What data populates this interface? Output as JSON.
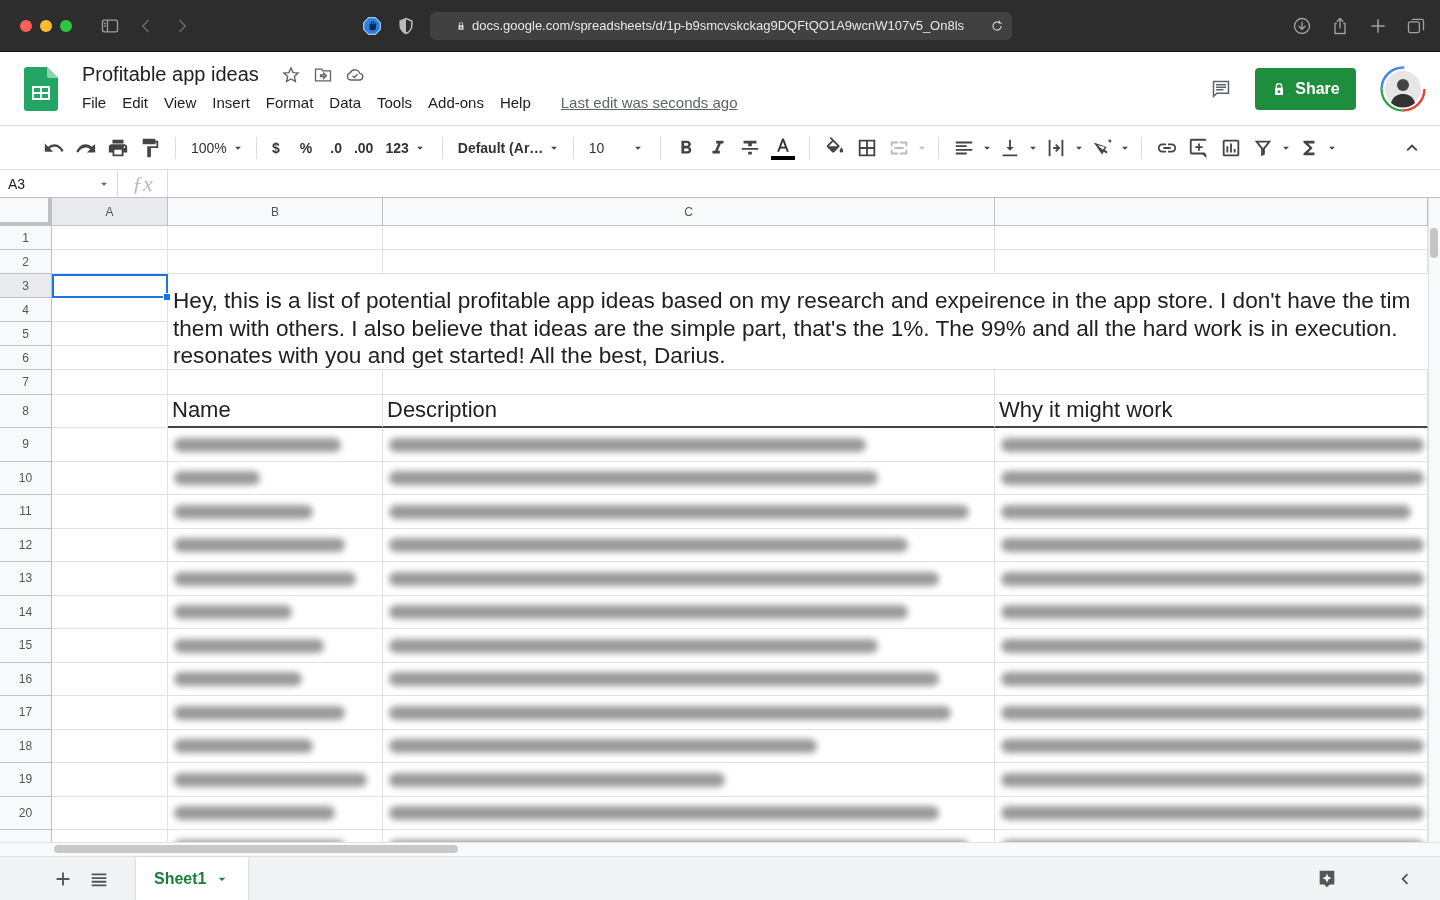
{
  "browser": {
    "url": "docs.google.com/spreadsheets/d/1p-b9smcvskckag9DQFtQO1A9wcnW107v5_On8ls"
  },
  "document": {
    "title": "Profitable app ideas",
    "menu": [
      "File",
      "Edit",
      "View",
      "Insert",
      "Format",
      "Data",
      "Tools",
      "Add-ons",
      "Help"
    ],
    "last_edit": "Last edit was seconds ago",
    "share": "Share"
  },
  "toolbar": {
    "zoom": "100%",
    "currency": "$",
    "percent": "%",
    "decrease_decimal": ".0",
    "increase_decimal": ".00",
    "number_format": "123",
    "font": "Default (Ar…",
    "font_size": "10"
  },
  "formula_bar": {
    "cell_reference": "A3",
    "function_label": "ƒx"
  },
  "grid": {
    "columns": [
      {
        "label": "A",
        "selected": true
      },
      {
        "label": "B",
        "selected": false
      },
      {
        "label": "C",
        "selected": false
      },
      {
        "selected": false
      }
    ],
    "intro_lines": [
      "Hey, this is a list of potential profitable app ideas based on my research and expeirence in the app store. I don't have the tim",
      "them with others. I also believe that ideas are the simple part, that's the 1%. The 99% and all the hard work is in execution.",
      "resonates with you and get started! All the best, Darius."
    ],
    "headers": [
      "Name",
      "Description",
      "Why it might work"
    ],
    "rows": [
      {
        "number": "1",
        "selected": false
      },
      {
        "number": "2",
        "selected": false
      },
      {
        "number": "3",
        "selected": true
      },
      {
        "number": "4",
        "selected": false
      },
      {
        "number": "5",
        "selected": false
      },
      {
        "number": "6",
        "selected": false
      },
      {
        "number": "7",
        "selected": false
      },
      {
        "number": "8",
        "selected": false
      },
      {
        "number": "9",
        "blurred": true,
        "selected": false
      },
      {
        "number": "10",
        "blurred": true,
        "selected": false
      },
      {
        "number": "11",
        "blurred": true,
        "selected": false
      },
      {
        "number": "12",
        "blurred": true,
        "selected": false
      },
      {
        "number": "13",
        "blurred": true,
        "selected": false
      },
      {
        "number": "14",
        "blurred": true,
        "selected": false
      },
      {
        "number": "15",
        "blurred": true,
        "selected": false
      },
      {
        "number": "16",
        "blurred": true,
        "selected": false
      },
      {
        "number": "17",
        "blurred": true,
        "selected": false
      },
      {
        "number": "18",
        "blurred": true,
        "selected": false
      },
      {
        "number": "19",
        "blurred": true,
        "selected": false
      },
      {
        "number": "20",
        "blurred": true,
        "selected": false
      },
      {
        "blurred": true,
        "selected": false
      }
    ]
  },
  "sheets": [
    {
      "label": "Sheet1",
      "selected": true
    }
  ]
}
